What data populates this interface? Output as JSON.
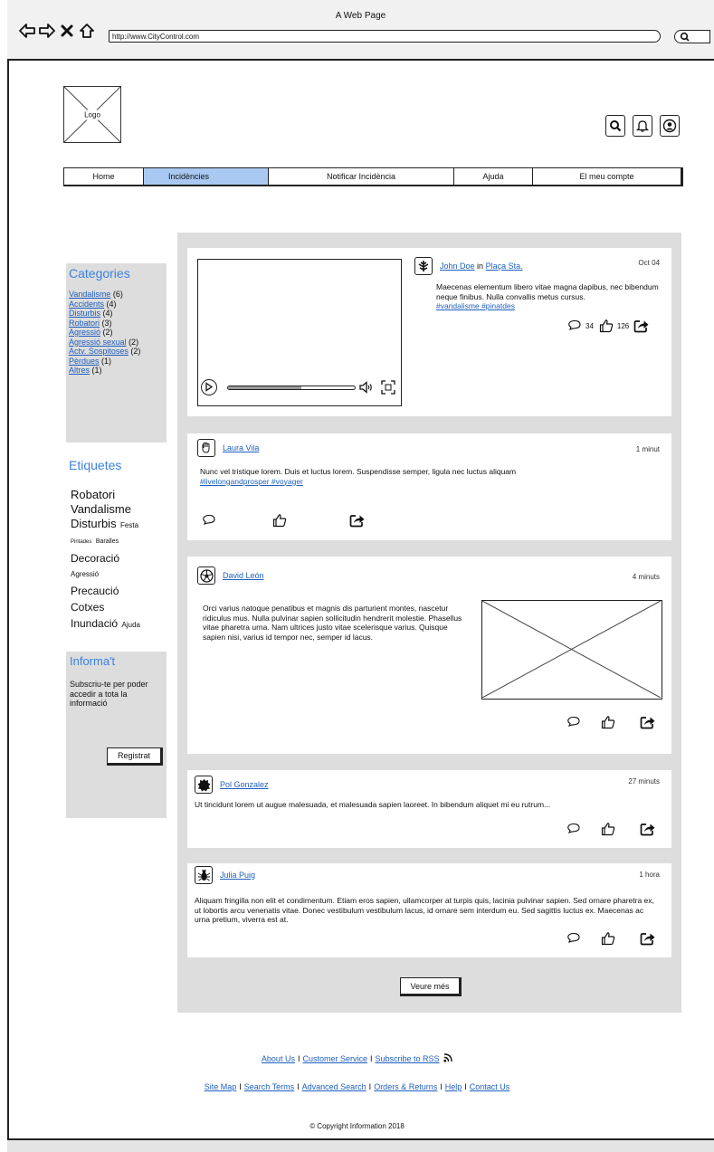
{
  "browser": {
    "window_title": "A Web Page",
    "url": "http://www.CityControl.com"
  },
  "header": {
    "logo_label": "Logo",
    "menu": [
      "Home",
      "Incidències",
      "Notificar Incidència",
      "Ajuda",
      "El meu compte"
    ],
    "active_menu": "Incidències"
  },
  "sidebar": {
    "categories_title": "Categories",
    "categories": [
      {
        "name": "Vandalisme",
        "count": "(6)"
      },
      {
        "name": "Accidents",
        "count": "(4)"
      },
      {
        "name": "Disturbis",
        "count": "(4)"
      },
      {
        "name": "Robatori",
        "count": "(3)"
      },
      {
        "name": "Agressió",
        "count": "(2)"
      },
      {
        "name": "Agressió sexual",
        "count": "(2)"
      },
      {
        "name": "Actv. Sospitoses",
        "count": "(2)"
      },
      {
        "name": "Pèrdues",
        "count": "(1)"
      },
      {
        "name": "Altres",
        "count": "(1)"
      }
    ],
    "tags_title": "Etiquetes",
    "tags": {
      "t1": "Robatori",
      "t2": "Vandalisme",
      "t3a": "Disturbis",
      "t3b": "Festa",
      "t4a": "Pintades",
      "t4b": "Baralles",
      "t5": "Decoració",
      "t6": "Agressió",
      "t7": "Precaució",
      "t8": "Cotxes",
      "t9a": "Inundació",
      "t9b": "Ajuda"
    },
    "inform_title": "Informa't",
    "inform_text": "Subscriu-te per poder accedir a tota la informació",
    "register_label": "Registrat"
  },
  "posts": [
    {
      "user": "John Doe",
      "in_label": "in",
      "place": "Plaça Sta.",
      "time": "Oct 04",
      "text": "Maecenas elementum libero vitae magna dapibus, nec bibendum neque finibus. Nulla convallis metus cursus.",
      "hashtags": "#vandalisme #pinatdes",
      "comments": "34",
      "likes": "126",
      "video_progress": 0.58
    },
    {
      "user": "Laura Vila",
      "time": "1 minut",
      "text": "Nunc vel tristique lorem. Duis et luctus lorem. Suspendisse semper, ligula nec luctus aliquam",
      "hashtags": "#livelongandprosper #voyager"
    },
    {
      "user": "David León",
      "time": "4 minuts",
      "text": "Orci varius natoque penatibus et magnis dis parturient montes, nascetur ridiculus mus. Nulla pulvinar sapien sollicitudin hendrerit molestie. Phasellus vitae pharetra urna. Nam ultrices justo vitae scelerisque varius. Quisque sapien nisi, varius id tempor nec, semper id lacus."
    },
    {
      "user": "Pol Gonzalez",
      "time": "27 minuts",
      "text": "Ut tincidunt lorem ut augue malesuada, et malesuada sapien laoreet. In bibendum aliquet mi eu rutrum..."
    },
    {
      "user": "Julia Puig",
      "time": "1 hora",
      "text": "Aliquam fringilla non elit et condimentum. Etiam eros sapien, ullamcorper at turpis quis, lacinia pulvinar sapien. Sed ornare pharetra ex, ut lobortis arcu venenatis vitae. Donec vestibulum vestibulum lacus, id ornare sem interdum eu. Sed sagittis luctus ex. Maecenas ac urna pretium, viverra est at."
    }
  ],
  "feed": {
    "more_label": "Veure més"
  },
  "footer": {
    "row1": [
      "About Us",
      "Customer Service",
      "Subscribe to RSS"
    ],
    "row2": [
      "Site Map",
      "Search Terms",
      "Advanced Search",
      "Orders & Returns",
      "Help",
      "Contact Us"
    ],
    "separator": "I",
    "copyright": "© Copyright Information 2018"
  },
  "colors": {
    "accent": "#3b82e0",
    "link": "#1f5fbf",
    "active_tab": "#a9c9f2",
    "panel": "#dddddd"
  }
}
